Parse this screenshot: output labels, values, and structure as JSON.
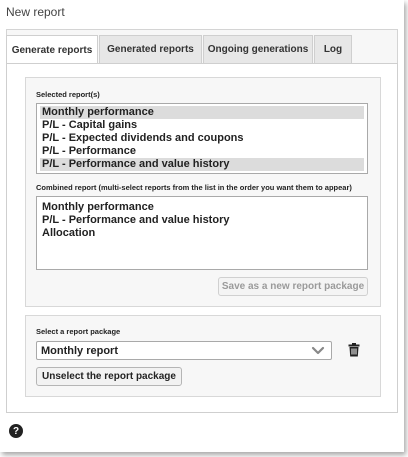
{
  "window": {
    "title": "New report"
  },
  "tabs": [
    {
      "label": "Generate reports"
    },
    {
      "label": "Generated reports"
    },
    {
      "label": "Ongoing generations"
    },
    {
      "label": "Log"
    }
  ],
  "selected_reports": {
    "label": "Selected report(s)",
    "items": [
      {
        "label": "Monthly performance",
        "selected": true
      },
      {
        "label": "P/L - Capital gains",
        "selected": false
      },
      {
        "label": "P/L - Expected dividends and coupons",
        "selected": false
      },
      {
        "label": "P/L - Performance",
        "selected": false
      },
      {
        "label": "P/L - Performance and value history",
        "selected": true
      }
    ]
  },
  "combined_report": {
    "label": "Combined report (multi-select reports from the list in the order you want them to appear)",
    "items": [
      "Monthly performance",
      "P/L - Performance and value history",
      "Allocation"
    ],
    "save_button": "Save as a new report package"
  },
  "report_package": {
    "label": "Select a report package",
    "selected_value": "Monthly report",
    "unselect_button": "Unselect the report package"
  },
  "help": {
    "glyph": "?"
  },
  "colors": {
    "selected_bg": "#dcdcdc",
    "panel_bg": "#f7f7f7",
    "icon": "#222222"
  }
}
